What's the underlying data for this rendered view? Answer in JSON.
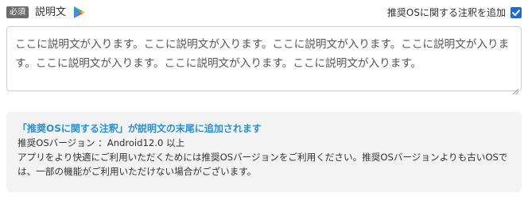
{
  "header": {
    "required_badge": "必須",
    "field_label": "説明文",
    "annotation_toggle_label": "推奨OSに関する注釈を追加",
    "annotation_checked": true
  },
  "description": {
    "text": "ここに説明文が入ります。ここに説明文が入ります。ここに説明文が入ります。ここに説明文が入ります。ここに説明文が入ります。ここに説明文が入ります。ここに説明文が入ります。"
  },
  "info": {
    "title": "「推奨OSに関する注釈」が説明文の末尾に追加されます",
    "os_version_line": "推奨OSバージョン ：Android12.0 以上",
    "notice": "アプリをより快適にご利用いただくためには推奨OSバージョンをご利用ください。推奨OSバージョンよりも古いOSでは、一部の機能がご利用いただけない場合がございます。"
  },
  "colors": {
    "accent_blue": "#1f6bd6",
    "info_title": "#2b8fd6",
    "badge_gray": "#6d6d6d",
    "info_bg": "#f3f3f3"
  },
  "icons": [
    "google-play-icon",
    "checkmark-icon",
    "resize-grip-icon"
  ]
}
